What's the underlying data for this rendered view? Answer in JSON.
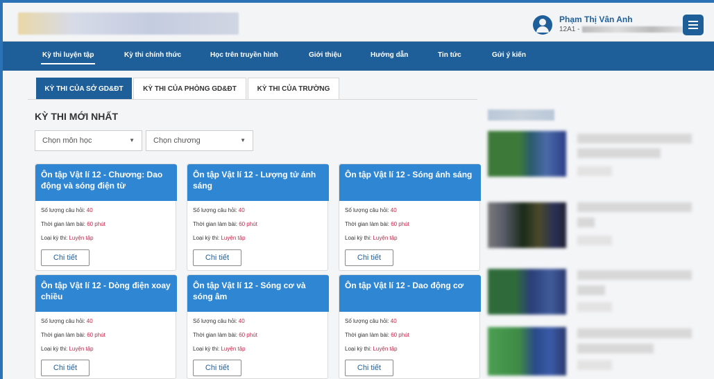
{
  "user": {
    "name": "Phạm Thị Vân Anh",
    "class_prefix": "12A1 -"
  },
  "nav": {
    "items": [
      {
        "label": "Kỳ thi luyện tập"
      },
      {
        "label": "Kỳ thi chính thức"
      },
      {
        "label": "Học trên truyền hình"
      },
      {
        "label": "Giới thiệu"
      },
      {
        "label": "Hướng dẫn"
      },
      {
        "label": "Tin tức"
      },
      {
        "label": "Gửi ý kiến"
      }
    ]
  },
  "tabs": [
    {
      "label": "KỲ THI CỦA SỞ GD&ĐT"
    },
    {
      "label": "KỲ THI CỦA PHÒNG GD&ĐT"
    },
    {
      "label": "KỲ THI CỦA TRƯỜNG"
    }
  ],
  "main": {
    "section_title": "KỲ THI MỚI NHẤT",
    "filters": {
      "subject_placeholder": "Chọn môn học",
      "chapter_placeholder": "Chọn chương"
    },
    "field_labels": {
      "count": "Số lượng câu hỏi:",
      "time": "Thời gian làm bài:",
      "type": "Loại kỳ thi:"
    },
    "detail_label": "Chi tiết",
    "cards": [
      {
        "title": "Ôn tập Vật lí 12 - Chương: Dao động và sóng điện từ",
        "count": "40",
        "time": "60 phút",
        "type": "Luyện tập"
      },
      {
        "title": "Ôn tập Vật lí 12 - Lượng tử ánh sáng",
        "count": "40",
        "time": "60 phút",
        "type": "Luyện tập"
      },
      {
        "title": "Ôn tập Vật lí 12 - Sóng ánh sáng",
        "count": "40",
        "time": "60 phút",
        "type": "Luyện tập"
      },
      {
        "title": "Ôn tập Vật lí 12 - Dòng điện xoay chiều",
        "count": "40",
        "time": "60 phút",
        "type": "Luyện tập"
      },
      {
        "title": "Ôn tập Vật lí 12 - Sóng cơ và sóng âm",
        "count": "40",
        "time": "60 phút",
        "type": "Luyện tập"
      },
      {
        "title": "Ôn tập Vật lí 12 - Dao động cơ",
        "count": "40",
        "time": "60 phút",
        "type": "Luyện tập"
      }
    ]
  },
  "colors": {
    "primary": "#1f5f99",
    "card_header": "#2f86d3",
    "value_accent": "#c0264a"
  }
}
